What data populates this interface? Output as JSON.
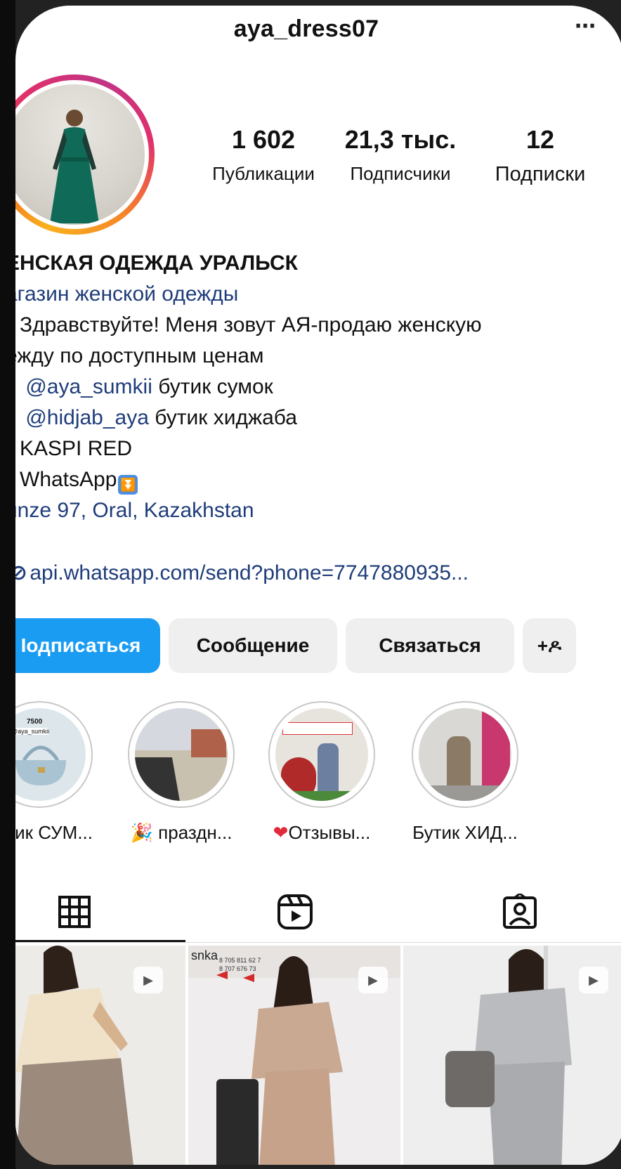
{
  "header": {
    "username": "aya_dress07",
    "more_icon": "more-dots-icon"
  },
  "stats": {
    "posts": {
      "value": "1 602",
      "label": "Публикации"
    },
    "followers": {
      "value": "21,3 тыс.",
      "label": "Подписчики"
    },
    "following": {
      "value": "12",
      "label": "Подписки"
    }
  },
  "bio": {
    "name": "ЕНСКАЯ ОДЕЖДА УРАЛЬСК",
    "category": "агазин женской одежды",
    "line1": "Здравствуйте! Меня зовут АЯ-продаю женскую",
    "line2": "ежду по доступным ценам",
    "mention1": "@aya_sumkii",
    "mention1_text": " бутик сумок",
    "mention2": "@hidjab_aya",
    "mention2_text": " бутик хиджаба",
    "kaspi": "KASPI RED",
    "whatsapp": "WhatsApp",
    "address": "unze 97, Oral, Kazakhstan",
    "link": "api.whatsapp.com/send?phone=7747880935..."
  },
  "actions": {
    "follow": "Іодписаться",
    "message": "Сообщение",
    "contact": "Связаться",
    "add_user_icon": "+ዶ"
  },
  "highlights": [
    {
      "label": "ик СУМ...",
      "badge": "7500",
      "handle": "@aya_sumkii"
    },
    {
      "label": "праздн..."
    },
    {
      "label": "Отзывы..."
    },
    {
      "label": "Бутик ХИД..."
    }
  ],
  "tabs": {
    "grid_icon": "grid-icon",
    "reels_icon": "reels-icon",
    "tagged_icon": "tagged-icon"
  },
  "posts": [
    {
      "type": "reel"
    },
    {
      "type": "reel",
      "sign": "snka",
      "phones": "8 705 811 62 7 / 8 707 676 73"
    },
    {
      "type": "reel"
    }
  ],
  "colors": {
    "primary_button": "#1a9cf2",
    "link_blue": "#1f3d7a"
  }
}
